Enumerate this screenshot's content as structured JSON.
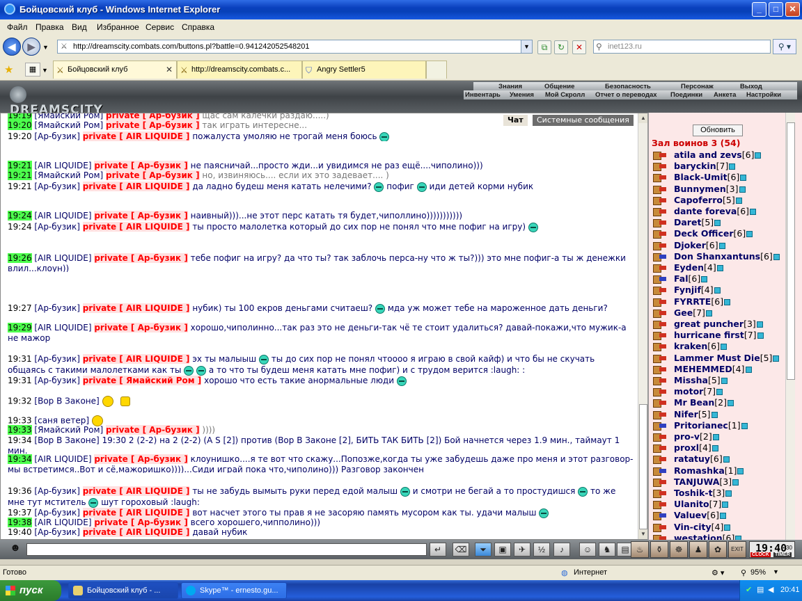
{
  "window": {
    "title": "Бойцовский клуб - Windows Internet Explorer"
  },
  "menu": [
    "Файл",
    "Правка",
    "Вид",
    "Избранное",
    "Сервис",
    "Справка"
  ],
  "address": {
    "url": "http://dreamscity.combats.com/buttons.pl?battle=0.941242052548201"
  },
  "search": {
    "placeholder": "inet123.ru"
  },
  "tabs": [
    {
      "label": "Бойцовский клуб"
    },
    {
      "label": "http://dreamscity.combats.c..."
    },
    {
      "label": "Angry Settler5"
    }
  ],
  "game": {
    "logo": "DREAMSCITY",
    "menu_top": [
      "Знания",
      "Общение",
      "Безопасность",
      "Персонаж",
      "Выход"
    ],
    "menu_bottom": [
      "Инвентарь",
      "Умения",
      "Мой Скролл",
      "Отчет о переводах",
      "Поединки",
      "Анкета",
      "Настройки"
    ]
  },
  "chat": {
    "tab_chat": "Чат",
    "tab_system": "Системные сообщения",
    "lines": {
      "l0": {
        "time": "19:19",
        "nick": "[Ямайский Ром]",
        "priv": "private [ Ар-бузик ]",
        "msg": "щас сам калечки раздаю.....)"
      },
      "l1": {
        "time": "19:20",
        "nick": "[Ямайский Ром]",
        "priv": "private [ Ар-бузик ]",
        "msg": "так играть интересне..."
      },
      "l2": {
        "time": "19:20",
        "nick": "[Ар-бузик]",
        "priv": "private [ AIR LIQUIDE ]",
        "msg": "пожалуста умоляю не трогай меня боюсь"
      },
      "l3": {
        "time": "19:21",
        "nick": "[AIR LIQUIDE]",
        "priv": "private [ Ар-бузик ]",
        "msg": "не паясничай...просто жди...и увидимся не раз ещё....чиполино)))"
      },
      "l4": {
        "time": "19:21",
        "nick": "[Ямайский Ром]",
        "priv": "private [ Ар-бузик ]",
        "msg": "но, извиняюсь.... если их это задевает.... )"
      },
      "l5": {
        "time": "19:21",
        "nick": "[Ар-бузик]",
        "priv": "private [ AIR LIQUIDE ]",
        "msg": "да ладно будеш меня катать нелечими?",
        "msg2": "пофиг",
        "msg3": "иди детей корми нубик"
      },
      "l6": {
        "time": "19:24",
        "nick": "[AIR LIQUIDE]",
        "priv": "private [ Ар-бузик ]",
        "msg": "наивный)))...не этот перс катать тя будет,чиполлино)))))))))))"
      },
      "l7": {
        "time": "19:24",
        "nick": "[Ар-бузик]",
        "priv": "private [ AIR LIQUIDE ]",
        "msg": "ты просто малолетка который до сих пор не понял что мне пофиг на игру)"
      },
      "l8": {
        "time": "19:26",
        "nick": "[AIR LIQUIDE]",
        "priv": "private [ Ар-бузик ]",
        "msg": "тебе пофиг на игру? да что ты? так заблочь перса-ну что ж ты?))) это мне пофиг-а ты ж денежки влил...клоун))"
      },
      "l9": {
        "time": "19:27",
        "nick": "[Ар-бузик]",
        "priv": "private [ AIR LIQUIDE ]",
        "msg": "нубик) ты 100 екров деньгами считаеш?",
        "msg2": "мда уж может тебе на мароженное дать деньги?"
      },
      "l10": {
        "time": "19:29",
        "nick": "[AIR LIQUIDE]",
        "priv": "private [ Ар-бузик ]",
        "msg": "хорошо,чиполинно...так раз это не деньги-так чё те стоит удалиться? давай-покажи,что мужик-а не мажор"
      },
      "l11": {
        "time": "19:31",
        "nick": "[Ар-бузик]",
        "priv": "private [ AIR LIQUIDE ]",
        "msg": "эх ты малыыш",
        "msg2": "ты до сих пор не понял чтоооо я играю в свой кайф) и что бы не скучать общаясь с такими малолетками как ты",
        "msg3": "а то что ты будеш меня катать мне пофиг) и с трудом верится :laugh: :"
      },
      "l12": {
        "time": "19:31",
        "nick": "[Ар-бузик]",
        "priv": "private [ Ямайский Ром ]",
        "msg": "хорошо что есть такие анормальные люди"
      },
      "l13": {
        "time": "19:32",
        "nick": "[Вор В Законе]",
        "msg": ""
      },
      "l14": {
        "time": "19:33",
        "nick": "[саня ветер]",
        "msg": ""
      },
      "l15": {
        "time": "19:33",
        "nick": "[Ямайский Ром]",
        "priv": "private [ Ар-бузик ]",
        "msg": "))))"
      },
      "l16": {
        "time": "19:34",
        "nick": "[Вор В Законе]",
        "msg": "19:30 2 (2-2) на 2 (2-2) (A S [2]) против (Вор В Законе [2], БИТЬ ТАК БИТЬ [2]) Бой начнется через 1.9 мин., таймаут 1 мин."
      },
      "l17": {
        "time": "19:34",
        "nick": "[AIR LIQUIDE]",
        "priv": "private [ Ар-бузик ]",
        "msg": "клоунишко....я те вот что скажу...Попозже,когда ты уже забудешь даже про меня и этот разговор-мы встретимся..Вот и сё,мажоришко))))...Сиди играй пока что,чиполино))) Разговор закончен"
      },
      "l18": {
        "time": "19:36",
        "nick": "[Ар-бузик]",
        "priv": "private [ AIR LIQUIDE ]",
        "msg": "ты не забудь вымыть руки перед едой малыш",
        "msg2": "и смотри не бегай а то простудишся",
        "msg3": "то же мне тут мститель",
        "msg4": "шут гороховый :laugh:"
      },
      "l19": {
        "time": "19:37",
        "nick": "[Ар-бузик]",
        "priv": "private [ AIR LIQUIDE ]",
        "msg": "вот насчет этого ты прав я не засоряю память мусором как ты. удачи малыш"
      },
      "l20": {
        "time": "19:38",
        "nick": "[AIR LIQUIDE]",
        "priv": "private [ Ар-бузик ]",
        "msg": "всего хорошего,чипполино)))"
      },
      "l21": {
        "time": "19:40",
        "nick": "[Ар-бузик]",
        "priv": "private [ AIR LIQUIDE ]",
        "msg": "давай нубик"
      }
    }
  },
  "room": {
    "refresh_label": "Обновить",
    "title": "Зал воинов 3 (54)",
    "players": [
      {
        "name": "atila and zevs",
        "level": "[6]"
      },
      {
        "name": "baryckin",
        "level": "[7]"
      },
      {
        "name": "Black-Umit",
        "level": "[6]"
      },
      {
        "name": "Bunnymen",
        "level": "[3]"
      },
      {
        "name": "Capoferro",
        "level": "[5]"
      },
      {
        "name": "dante foreva",
        "level": "[6]"
      },
      {
        "name": "Daret",
        "level": "[5]"
      },
      {
        "name": "Deck Officer",
        "level": "[6]"
      },
      {
        "name": "Djoker",
        "level": "[6]"
      },
      {
        "name": "Don Shanxantuns",
        "level": "[6]"
      },
      {
        "name": "Eyden",
        "level": "[4]"
      },
      {
        "name": "Fal",
        "level": "[6]"
      },
      {
        "name": "Fynjif",
        "level": "[4]"
      },
      {
        "name": "FYRRTE",
        "level": "[6]"
      },
      {
        "name": "Gee",
        "level": "[7]"
      },
      {
        "name": "great puncher",
        "level": "[3]"
      },
      {
        "name": "hurricane first",
        "level": "[7]"
      },
      {
        "name": "kraken",
        "level": "[6]"
      },
      {
        "name": "Lammer Must Die",
        "level": "[5]"
      },
      {
        "name": "MEHEMMED",
        "level": "[4]"
      },
      {
        "name": "Missha",
        "level": "[5]"
      },
      {
        "name": "motor",
        "level": "[7]"
      },
      {
        "name": "Mr Bean",
        "level": "[2]"
      },
      {
        "name": "Nifer",
        "level": "[5]"
      },
      {
        "name": "Pritorianec",
        "level": "[1]"
      },
      {
        "name": "pro-v",
        "level": "[2]"
      },
      {
        "name": "proxl",
        "level": "[4]"
      },
      {
        "name": "ratatuy",
        "level": "[6]"
      },
      {
        "name": "Romashka",
        "level": "[1]"
      },
      {
        "name": "TANJUWA",
        "level": "[3]"
      },
      {
        "name": "Toshik-t",
        "level": "[3]"
      },
      {
        "name": "Ulanito",
        "level": "[7]"
      },
      {
        "name": "Valuev",
        "level": "[6]"
      },
      {
        "name": "Vin-city",
        "level": "[4]"
      },
      {
        "name": "westation",
        "level": "[6]"
      }
    ]
  },
  "clock": {
    "time": "19:40",
    "seconds": "30",
    "clock_label": "CLOCK",
    "timer_label": "TIMER"
  },
  "statusbar": {
    "status": "Готово",
    "zone": "Интернет",
    "zoom": "95%"
  },
  "taskbar": {
    "start": "пуск",
    "tasks": [
      "Бойцовский клуб - ...",
      "Skype™ - ernesto.gu..."
    ],
    "time": "20:41"
  }
}
